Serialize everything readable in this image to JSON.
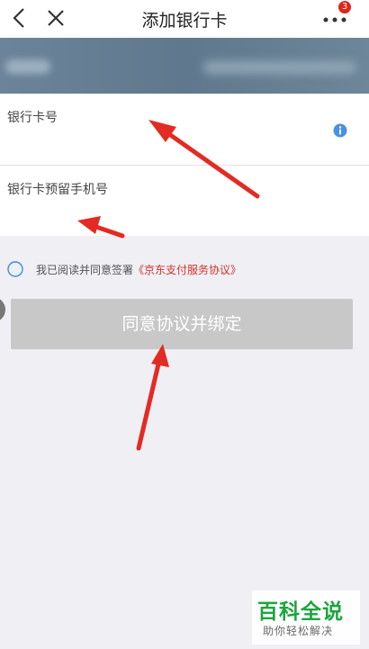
{
  "nav": {
    "title": "添加银行卡",
    "badge_count": "3",
    "icons": {
      "back": "chevron-left-icon",
      "close": "close-icon",
      "more": "more-dots-icon"
    }
  },
  "form": {
    "card_number_label": "银行卡号",
    "phone_label": "银行卡预留手机号",
    "icons": {
      "info": "info-icon"
    }
  },
  "agreement": {
    "prefix": "我已阅读并同意签署",
    "link": "《京东支付服务协议》"
  },
  "button": {
    "label": "同意协议并绑定"
  },
  "watermark": {
    "title": "百科全说",
    "subtitle": "助你轻松解决"
  },
  "colors": {
    "banner": "#6a8296",
    "button_disabled": "#c8c8c8",
    "link": "#d4322c",
    "info": "#4a90e2",
    "radio": "#3a8ee6",
    "arrow": "#e32b23",
    "watermark_green": "#1ca53d"
  }
}
